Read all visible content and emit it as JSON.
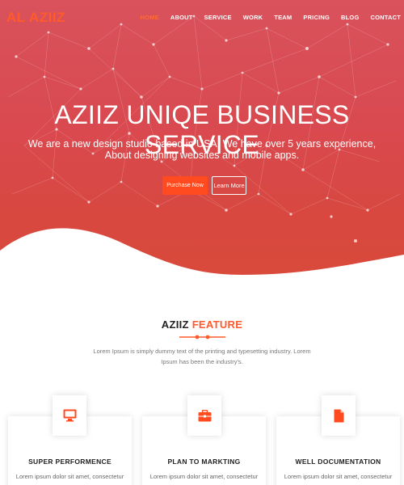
{
  "brand": {
    "logo": "AL AZIIZ",
    "accent": "#ff5a2c"
  },
  "nav": {
    "items": [
      {
        "label": "HOME",
        "active": true
      },
      {
        "label": "ABOUT"
      },
      {
        "label": "SERVICE"
      },
      {
        "label": "WORK"
      },
      {
        "label": "TEAM"
      },
      {
        "label": "PRICING"
      },
      {
        "label": "BLOG"
      },
      {
        "label": "CONTACT"
      }
    ]
  },
  "hero": {
    "title": "AZIIZ UNIQE BUSINESS SERVICE",
    "subtitle_line1": "We are a new design studio based in USA. We have over 5 years experience,",
    "subtitle_line2": "About designing websites and mobile apps.",
    "primary_button": "Purchase Now",
    "secondary_button": "Learn More",
    "colors": {
      "gradient_top": "#d9525c",
      "gradient_bottom": "#d94a3a"
    }
  },
  "features": {
    "title_main": "AZIIZ",
    "title_accent": "FEATURE",
    "description_line1": "Lorem Ipsum is simply dummy text of the printing and typesetting industry. Lorem",
    "description_line2": "Ipsum has been the industry's.",
    "cards": [
      {
        "icon": "monitor-icon",
        "title": "SUPER PERFORMENCE",
        "text": "Lorem ipsum dolor sit amet, consectetur"
      },
      {
        "icon": "briefcase-icon",
        "title": "PLAN TO MARKTING",
        "text": "Lorem ipsum dolor sit amet, consectetur"
      },
      {
        "icon": "document-icon",
        "title": "WELL DOCUMENTATION",
        "text": "Lorem ipsum dolor sit amet, consectetur"
      }
    ]
  }
}
